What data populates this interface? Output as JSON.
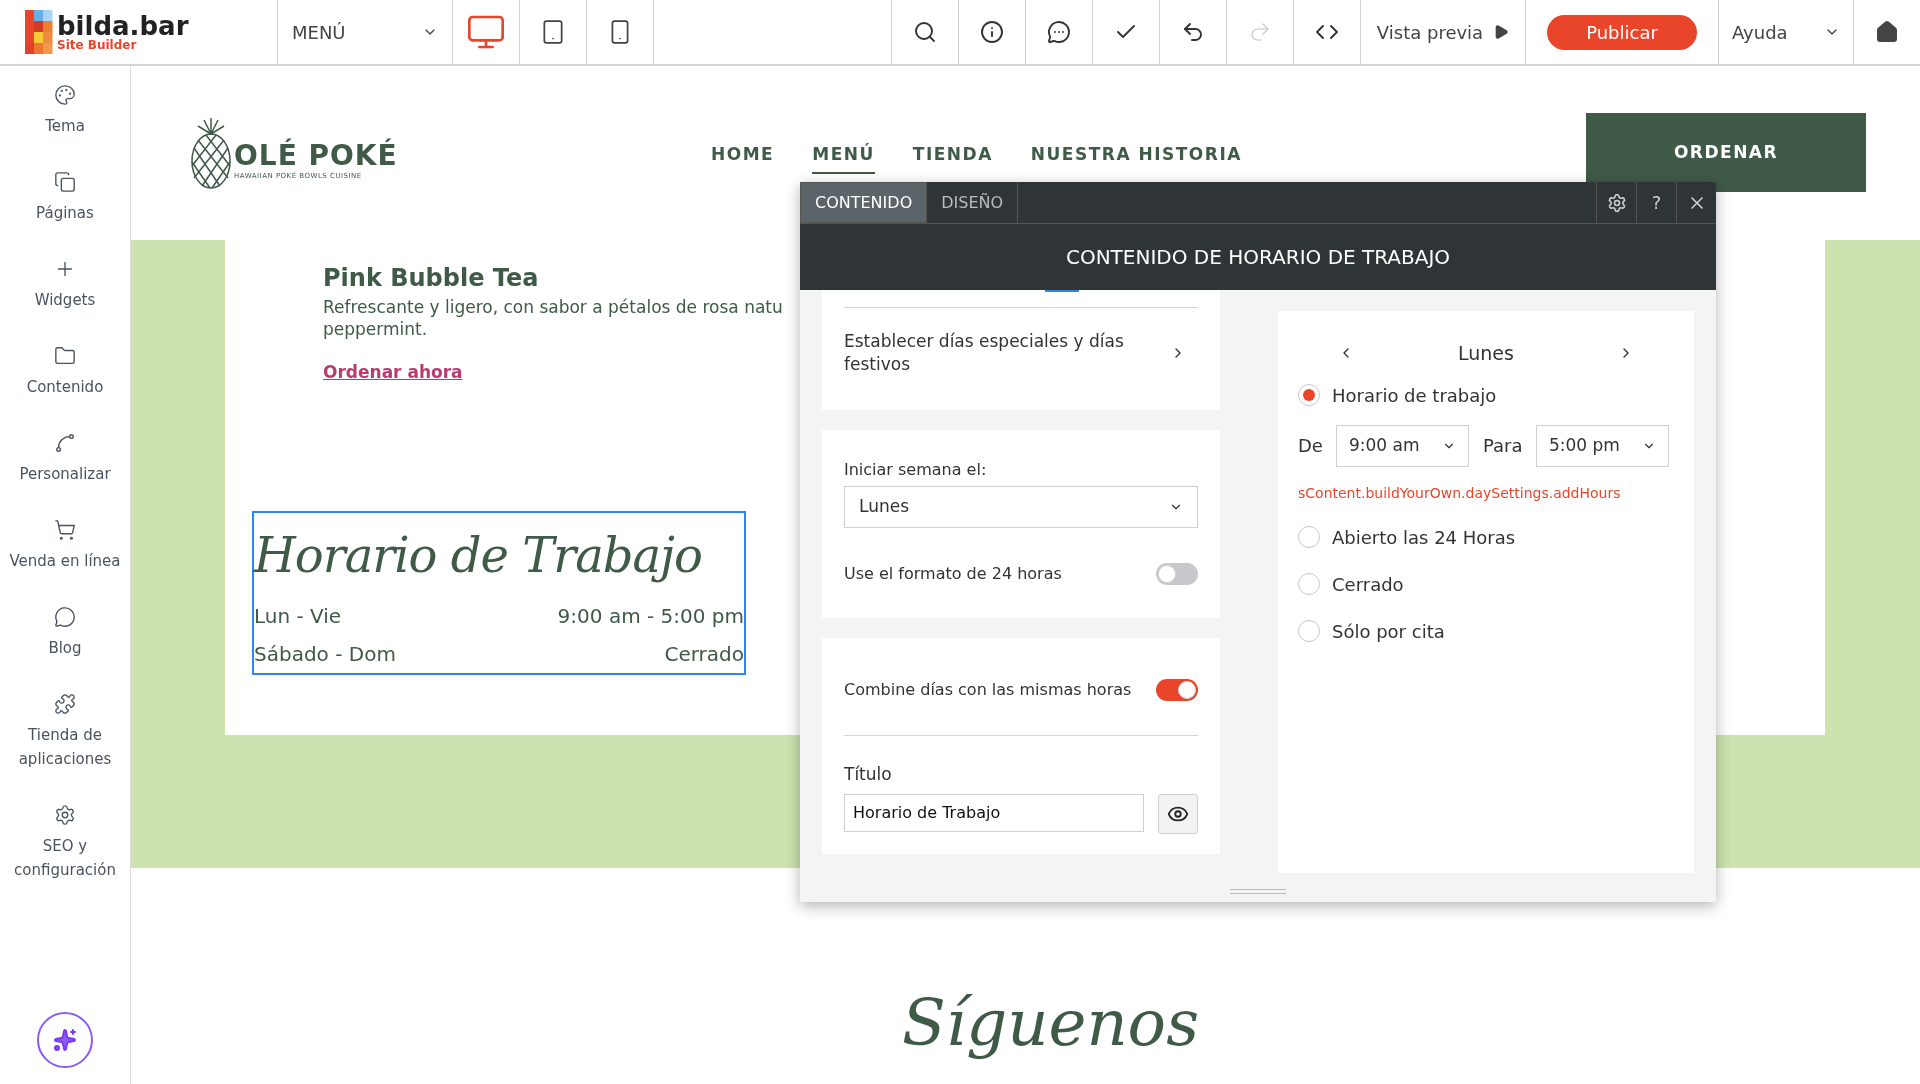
{
  "topbar": {
    "logo": {
      "name": "bilda.bar",
      "tagline": "Site Builder"
    },
    "page_select": "MENÚ",
    "devices": [
      {
        "kind": "desktop",
        "selected": true
      },
      {
        "kind": "tablet",
        "selected": false
      },
      {
        "kind": "mobile",
        "selected": false
      }
    ],
    "tools": [
      {
        "kind": "search",
        "disabled": false
      },
      {
        "kind": "info",
        "disabled": false
      },
      {
        "kind": "comment",
        "disabled": false
      },
      {
        "kind": "check",
        "disabled": false
      },
      {
        "kind": "undo",
        "disabled": false
      },
      {
        "kind": "redo",
        "disabled": true
      },
      {
        "kind": "code",
        "disabled": false
      }
    ],
    "preview": "Vista previa",
    "publish": "Publicar",
    "help": "Ayuda"
  },
  "sidebar": {
    "items": [
      {
        "kind": "palette",
        "label": "Tema"
      },
      {
        "kind": "pages",
        "label": "Páginas"
      },
      {
        "kind": "plus",
        "label": "Widgets"
      },
      {
        "kind": "folder",
        "label": "Contenido"
      },
      {
        "kind": "curve",
        "label": "Personalizar"
      },
      {
        "kind": "cart",
        "label": "Venda en línea"
      },
      {
        "kind": "chat",
        "label": "Blog"
      },
      {
        "kind": "puzzle",
        "label": "Tienda de aplicaciones"
      },
      {
        "kind": "gear",
        "label": "SEO y configuración"
      }
    ]
  },
  "site": {
    "logo": {
      "name": "OLÉ POKÉ",
      "tagline": "HAWAIIAN POKÉ BOWLS CUISINE"
    },
    "nav": [
      {
        "label": "HOME",
        "selected": false
      },
      {
        "label": "MENÚ",
        "selected": true
      },
      {
        "label": "TIENDA",
        "selected": false
      },
      {
        "label": "NUESTRA HISTORIA",
        "selected": false
      }
    ],
    "order_button": "ORDENAR",
    "item": {
      "title": "Pink Bubble Tea",
      "description": [
        "Refrescante y ligero, con sabor a pétalos de rosa natu",
        "peppermint."
      ],
      "link": "Ordenar ahora"
    },
    "hours_widget": {
      "title": "Horario de Trabajo",
      "selected": true,
      "rows": [
        {
          "days": "Lun - Vie",
          "hours": "9:00 am - 5:00 pm"
        },
        {
          "days": "Sábado - Dom",
          "hours": "Cerrado"
        }
      ]
    },
    "follow_title": "Síguenos"
  },
  "dialog": {
    "tabs": [
      {
        "label": "CONTENIDO",
        "selected": true
      },
      {
        "label": "DISEÑO",
        "selected": false
      }
    ],
    "help_label": "?",
    "header": "CONTENIDO DE HORARIO DE TRABAJO",
    "special_days": "Establecer días especiales y días festivos",
    "week_start": {
      "label": "Iniciar semana el:",
      "value": "Lunes"
    },
    "toggles": [
      {
        "label": "Use el formato de 24 horas",
        "on": false
      },
      {
        "label": "Combine días con las mismas horas",
        "on": true
      }
    ],
    "title_field": {
      "label": "Título",
      "value": "Horario de Trabajo"
    },
    "day": {
      "name": "Lunes",
      "from_label": "De",
      "from": "9:00 am",
      "to_label": "Para",
      "to": "5:00 pm",
      "error": "sContent.buildYourOwn.daySettings.addHours",
      "options": [
        {
          "label": "Horario de trabajo",
          "selected": true
        },
        {
          "label": "Abierto las 24 Horas",
          "selected": false
        },
        {
          "label": "Cerrado",
          "selected": false
        },
        {
          "label": "Sólo por cita",
          "selected": false
        }
      ]
    }
  }
}
